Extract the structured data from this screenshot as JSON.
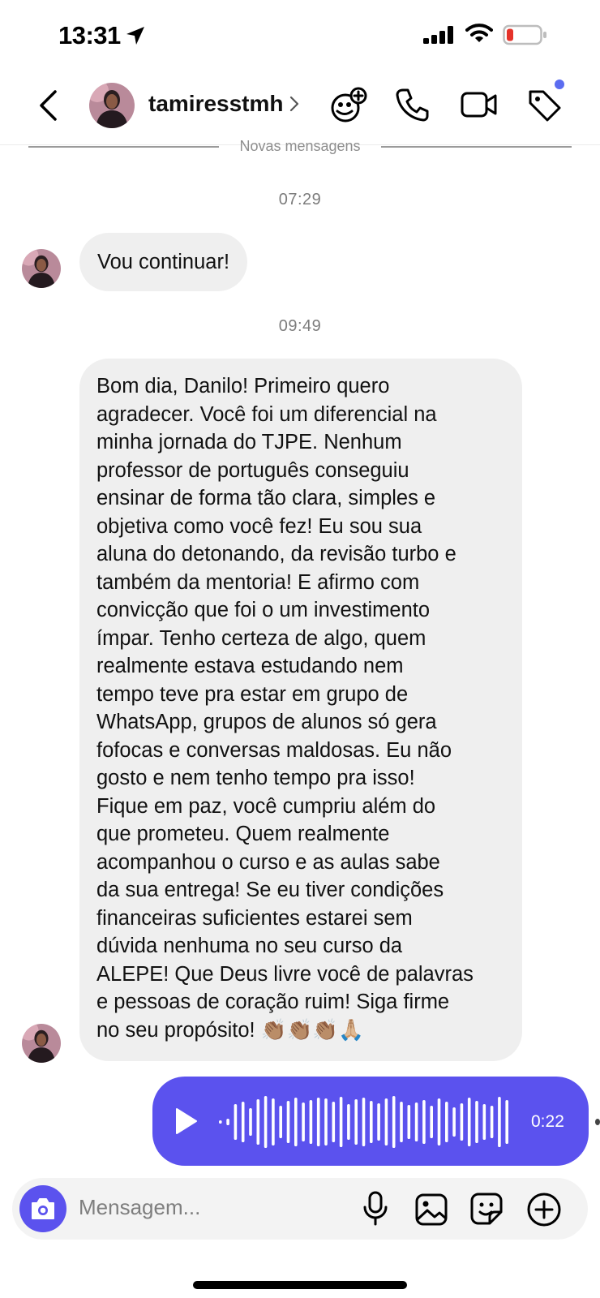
{
  "status_bar": {
    "time": "13:31"
  },
  "header": {
    "username": "tamiresstmh"
  },
  "divider": {
    "label": "Novas mensagens"
  },
  "messages": [
    {
      "timestamp": "07:29",
      "text": "Vou continuar!"
    },
    {
      "timestamp": "09:49",
      "lines": [
        "Bom dia, Danilo! Primeiro quero",
        "agradecer. Você foi um diferencial na",
        "minha jornada do TJPE. Nenhum",
        "professor de português conseguiu",
        "ensinar de forma tão clara, simples e",
        "objetiva como você fez! Eu sou sua",
        "aluna do detonando, da revisão turbo e",
        "também da mentoria! E afirmo com",
        "convicção que foi o um investimento",
        "ímpar. Tenho certeza de algo, quem",
        "realmente estava estudando nem",
        "tempo teve pra estar em grupo de",
        "WhatsApp, grupos de alunos só gera",
        "fofocas e conversas maldosas. Eu não",
        "gosto e nem tenho tempo pra isso!",
        "Fique em paz, você cumpriu além do",
        "que prometeu. Quem realmente",
        "acompanhou o curso e as aulas sabe",
        "da sua entrega! Se eu tiver condições",
        "financeiras suficientes estarei sem",
        "dúvida nenhuma no seu curso da",
        "ALEPE! Que Deus livre você de palavras",
        "e pessoas de coração ruim! Siga firme",
        "no seu propósito! 👏🏽👏🏽👏🏽🙏🏼"
      ]
    }
  ],
  "voice_message": {
    "duration": "0:22"
  },
  "composer": {
    "placeholder": "Mensagem..."
  },
  "colors": {
    "accent": "#5b52ee",
    "bubble": "#efefef",
    "notification_dot": "#5b6cf0",
    "battery_low": "#e5332a"
  },
  "icons": [
    "location-arrow-icon",
    "signal-icon",
    "wifi-icon",
    "battery-icon",
    "back-chevron-icon",
    "chevron-right-icon",
    "add-people-icon",
    "phone-icon",
    "video-icon",
    "tag-icon",
    "play-icon",
    "camera-icon",
    "microphone-icon",
    "gallery-icon",
    "sticker-icon",
    "plus-icon"
  ]
}
